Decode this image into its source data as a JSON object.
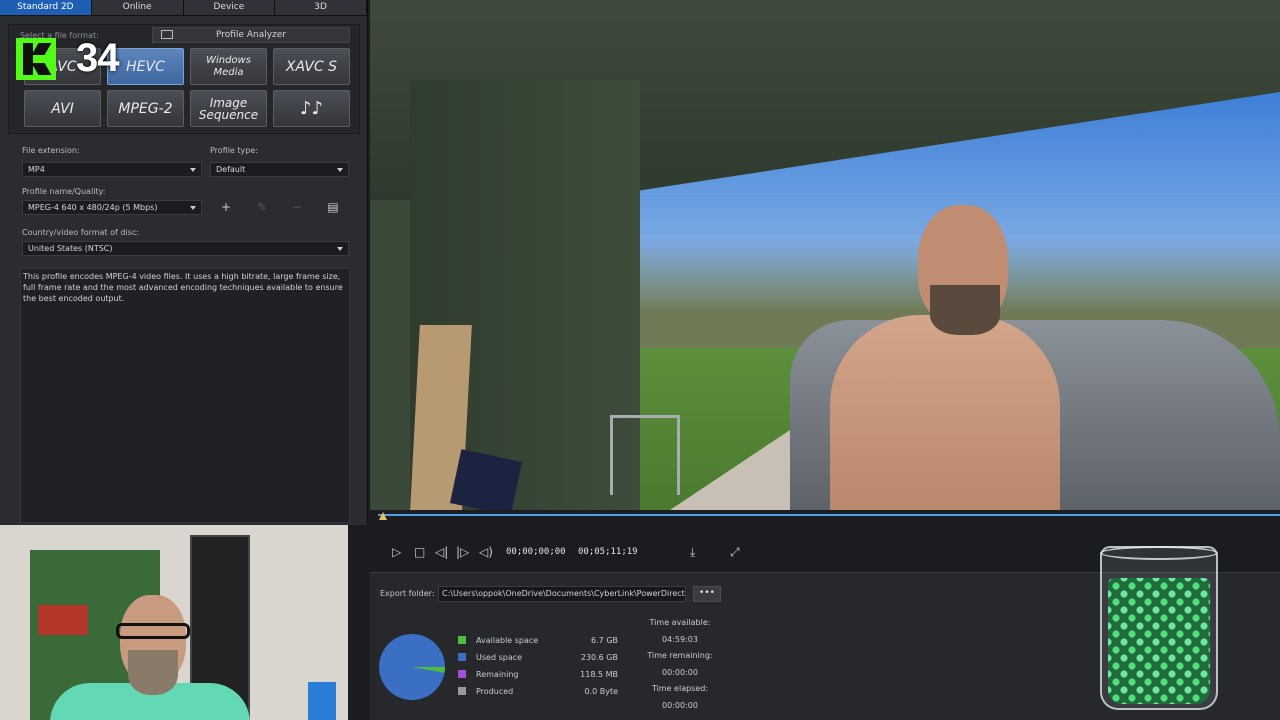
{
  "tabs": [
    "Standard 2D",
    "Online",
    "Device",
    "3D"
  ],
  "active_tab": "Standard 2D",
  "format_section": {
    "label": "Select a file format:",
    "profile_analyzer": "Profile Analyzer",
    "formats": [
      {
        "label": "AVC",
        "selected": false
      },
      {
        "label": "HEVC",
        "selected": true
      },
      {
        "label": "Windows Media",
        "selected": false
      },
      {
        "label": "XAVC S",
        "selected": false
      },
      {
        "label": "AVI",
        "selected": false
      },
      {
        "label": "MPEG-2",
        "selected": false
      },
      {
        "label": "Image Sequence",
        "selected": false
      },
      {
        "label": "♪♪",
        "selected": false
      }
    ]
  },
  "file_extension": {
    "label": "File extension:",
    "value": "MP4"
  },
  "profile_type": {
    "label": "Profile type:",
    "value": "Default"
  },
  "profile_quality": {
    "label": "Profile name/Quality:",
    "value": "MPEG-4 640 x 480/24p (5 Mbps)"
  },
  "country_format": {
    "label": "Country/video format of disc:",
    "value": "United States (NTSC)"
  },
  "description": "This profile encodes MPEG-4 video files. It uses a high bitrate, large frame size, full frame rate and the most advanced encoding techniques available to ensure the best encoded output.",
  "kick_badge": {
    "number": "34",
    "icon": "kick-logo-icon"
  },
  "player": {
    "current_time": "00;00;00;00",
    "total_time": "00;05;11;19",
    "progress": 0.0
  },
  "export": {
    "folder_label": "Export folder:",
    "folder_path": "C:\\Users\\oppok\\OneDrive\\Documents\\CyberLink\\PowerDirector",
    "browse_label": "•••"
  },
  "disk_usage": {
    "items": [
      {
        "label": "Available space",
        "value": "6.7 GB",
        "color": "#4fbe3f"
      },
      {
        "label": "Used space",
        "value": "230.6 GB",
        "color": "#3a6fc4"
      },
      {
        "label": "Remaining",
        "value": "118.5 MB",
        "color": "#a24fd1"
      },
      {
        "label": "Produced",
        "value": "0.0 Byte",
        "color": "#9a9a9a"
      }
    ],
    "available_fraction": 0.028
  },
  "times": {
    "available_label": "Time available:",
    "available_value": "04:59:03",
    "remaining_label": "Time remaining:",
    "remaining_value": "00:00:00",
    "elapsed_label": "Time elapsed:",
    "elapsed_value": "00:00:00"
  },
  "colors": {
    "accent": "#1e5fb4",
    "timeline": "#4fa0e6",
    "kick_green": "#53fc18"
  }
}
